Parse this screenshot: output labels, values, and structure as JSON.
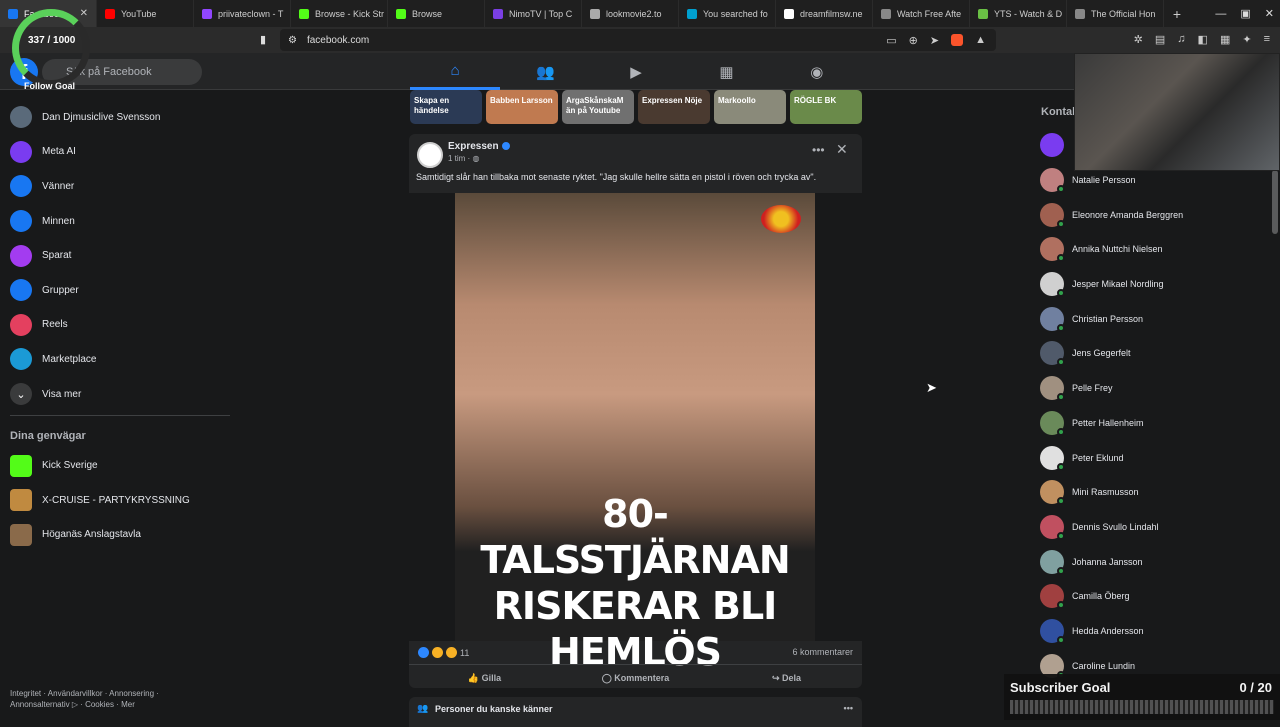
{
  "browser": {
    "tabs": [
      {
        "label": "Facebook",
        "color": "#1877f2"
      },
      {
        "label": "YouTube",
        "color": "#ff0000"
      },
      {
        "label": "priivateclown - T",
        "color": "#9146ff"
      },
      {
        "label": "Browse - Kick Str",
        "color": "#53fc18"
      },
      {
        "label": "Browse",
        "color": "#53fc18"
      },
      {
        "label": "NimoTV | Top C",
        "color": "#7b3fe4"
      },
      {
        "label": "lookmovie2.to",
        "color": "#aaaaaa"
      },
      {
        "label": "You searched fo",
        "color": "#00a0d0"
      },
      {
        "label": "dreamfilmsw.ne",
        "color": "#ffffff"
      },
      {
        "label": "Watch Free Afte",
        "color": "#888888"
      },
      {
        "label": "YTS - Watch & D",
        "color": "#6ac045"
      },
      {
        "label": "The Official Hon",
        "color": "#888888"
      }
    ],
    "url": "facebook.com"
  },
  "stream_overlay": {
    "follow_count": "337 / 1000",
    "follow_label": "Follow Goal",
    "sub_label": "Subscriber Goal",
    "sub_count": "0 / 20",
    "sub_progress": 0
  },
  "facebook": {
    "search_placeholder": "Sök på Facebook",
    "sidebar": [
      {
        "label": "Dan Djmusiclive Svensson",
        "icon": "avatar-icon",
        "color": "#5a6a7a"
      },
      {
        "label": "Meta AI",
        "icon": "meta-ai-icon",
        "color": "#7a3cf0"
      },
      {
        "label": "Vänner",
        "icon": "friends-icon",
        "color": "#1877f2"
      },
      {
        "label": "Minnen",
        "icon": "memories-icon",
        "color": "#1877f2"
      },
      {
        "label": "Sparat",
        "icon": "saved-icon",
        "color": "#a33cf0"
      },
      {
        "label": "Grupper",
        "icon": "groups-icon",
        "color": "#1877f2"
      },
      {
        "label": "Reels",
        "icon": "reels-icon",
        "color": "#e4405f"
      },
      {
        "label": "Marketplace",
        "icon": "marketplace-icon",
        "color": "#1b9ad6"
      },
      {
        "label": "Visa mer",
        "icon": "chevron-down-icon",
        "color": "#3a3b3c"
      }
    ],
    "shortcuts_heading": "Dina genvägar",
    "shortcuts": [
      {
        "label": "Kick Sverige",
        "color": "#53fc18"
      },
      {
        "label": "X-CRUISE - PARTYKRYSSNING",
        "color": "#c08a40"
      },
      {
        "label": "Höganäs Anslagstavla",
        "color": "#8a6a4a"
      }
    ],
    "footer": "Integritet · Användarvillkor · Annonsering · Annonsalternativ ▷ · Cookies · Mer",
    "stories": [
      {
        "label": "Skapa en händelse",
        "color": "#2b3a55"
      },
      {
        "label": "Babben Larsson",
        "color": "#c07a50"
      },
      {
        "label": "ArgaSkånskaM än på Youtube",
        "color": "#707070"
      },
      {
        "label": "Expressen Nöje",
        "color": "#4a3a30"
      },
      {
        "label": "Markoollo",
        "color": "#8a8a7a"
      },
      {
        "label": "RÖGLE BK",
        "color": "#6a8a4a"
      }
    ],
    "post": {
      "author": "Expressen",
      "time": "1 tim ·",
      "text": "Samtidigt slår han tillbaka mot senaste ryktet. \"Jag skulle hellre sätta en pistol i röven och trycka av\".",
      "headline_1": "80-TALSSTJÄRNAN",
      "headline_2": "RISKERAR BLI",
      "headline_3": "HEMLÖS",
      "reactions_count": "11",
      "comments_count": "6 kommentarer",
      "like_label": "Gilla",
      "comment_label": "Kommentera",
      "share_label": "Dela"
    },
    "people_heading": "Personer du kanske känner",
    "contacts_heading": "Kontakter",
    "contacts": [
      {
        "name": "",
        "color": "#7a3cf0"
      },
      {
        "name": "Natalie Persson",
        "color": "#c08080"
      },
      {
        "name": "Eleonore Amanda Berggren",
        "color": "#a06050"
      },
      {
        "name": "Annika Nuttchi Nielsen",
        "color": "#b07060"
      },
      {
        "name": "Jesper Mikael Nordling",
        "color": "#d0d0d0"
      },
      {
        "name": "Christian Persson",
        "color": "#7080a0"
      },
      {
        "name": "Jens Gegerfelt",
        "color": "#505a6a"
      },
      {
        "name": "Pelle Frey",
        "color": "#a09080"
      },
      {
        "name": "Petter Hallenheim",
        "color": "#6a8a5a"
      },
      {
        "name": "Peter Eklund",
        "color": "#e0e0e0"
      },
      {
        "name": "Mini Rasmusson",
        "color": "#c09060"
      },
      {
        "name": "Dennis Svullo Lindahl",
        "color": "#c05060"
      },
      {
        "name": "Johanna Jansson",
        "color": "#80a0a0"
      },
      {
        "name": "Camilla Öberg",
        "color": "#a04040"
      },
      {
        "name": "Hedda Andersson",
        "color": "#3050a0"
      },
      {
        "name": "Caroline Lundin",
        "color": "#b0a090"
      }
    ]
  }
}
